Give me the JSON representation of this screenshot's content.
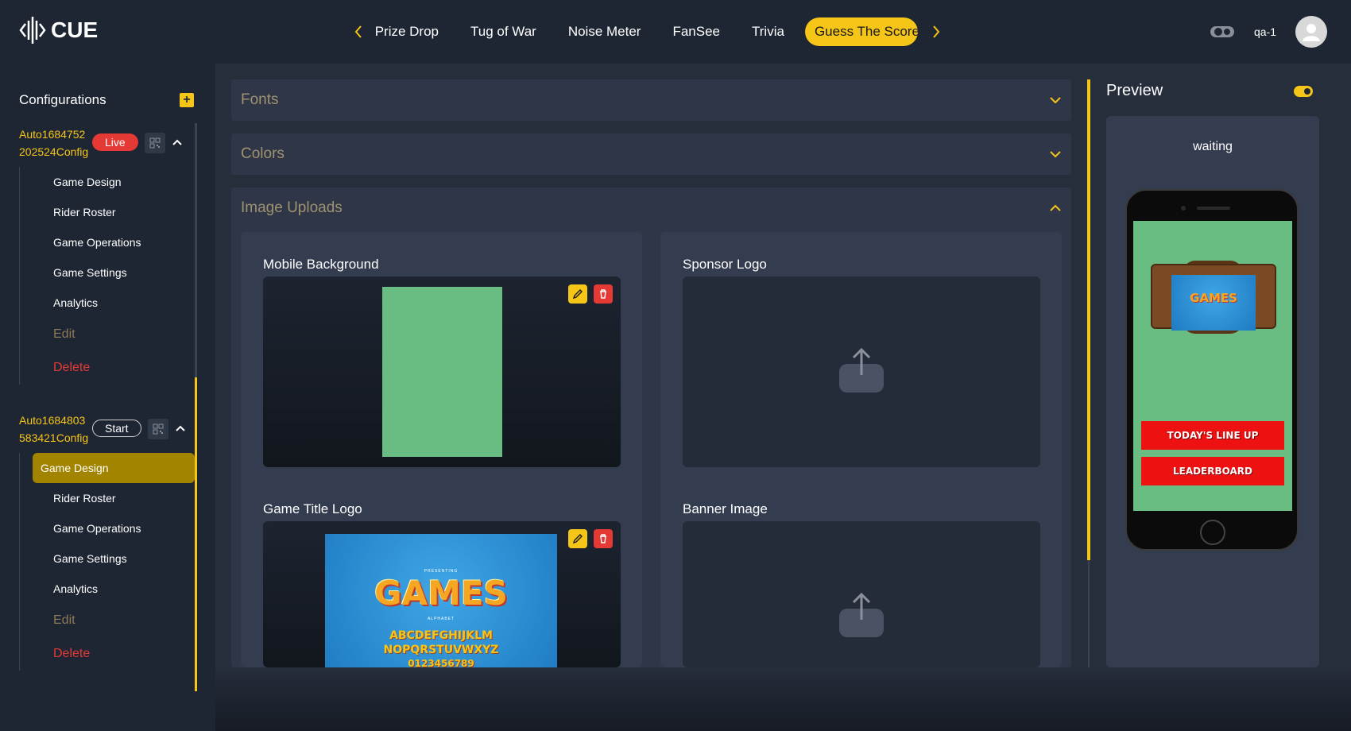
{
  "app": {
    "logo_text": "CUE"
  },
  "nav": {
    "items": [
      "Prize Drop",
      "Tug of War",
      "Noise Meter",
      "FanSee",
      "Trivia"
    ],
    "active": "Guess The Score"
  },
  "user": {
    "name": "qa-1"
  },
  "sidebar": {
    "title": "Configurations",
    "configs": [
      {
        "name": "Auto1684752202524Config",
        "status": "Live",
        "items": [
          "Game Design",
          "Rider Roster",
          "Game Operations",
          "Game Settings",
          "Analytics"
        ],
        "edit": "Edit",
        "delete": "Delete"
      },
      {
        "name": "Auto1684803583421Config",
        "status": "Start",
        "items": [
          "Game Design",
          "Rider Roster",
          "Game Operations",
          "Game Settings",
          "Analytics"
        ],
        "edit": "Edit",
        "delete": "Delete"
      }
    ]
  },
  "sections": {
    "fonts": "Fonts",
    "colors": "Colors",
    "image_uploads": "Image Uploads"
  },
  "uploads": {
    "mobile_background": "Mobile Background",
    "sponsor_logo": "Sponsor Logo",
    "game_title_logo": "Game Title Logo",
    "banner_image": "Banner Image"
  },
  "logo_image": {
    "presenting": "PRESENTING",
    "title": "GAMES",
    "alphabet": "ALPHABET",
    "line1": "ABCDEFGHIJKLM",
    "line2": "NOPQRSTUVWXYZ",
    "line3": "0123456789"
  },
  "preview": {
    "title": "Preview",
    "status": "waiting",
    "button1": "TODAY'S LINE UP",
    "button2": "LEADERBOARD"
  },
  "colors": {
    "accent": "#f5c518",
    "danger": "#e53935",
    "background": "#1f2633",
    "panel": "#2e3647",
    "mobile_bg": "#69bd82"
  }
}
